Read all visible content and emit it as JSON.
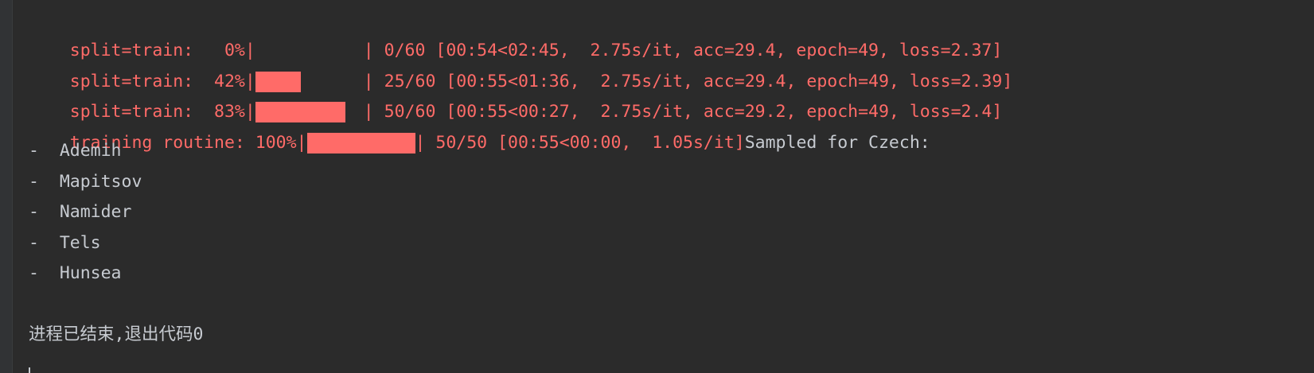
{
  "console": {
    "progress_lines": [
      {
        "label": "split=train:   0%|",
        "fraction": 0.0,
        "tail": "| 0/60 [00:54<02:45,  2.75s/it, acc=29.4, epoch=49, loss=2.37]"
      },
      {
        "label": "split=train:  42%|",
        "fraction": 0.42,
        "tail": "| 25/60 [00:55<01:36,  2.75s/it, acc=29.4, epoch=49, loss=2.39]"
      },
      {
        "label": "split=train:  83%|",
        "fraction": 0.83,
        "tail": "| 50/60 [00:55<00:27,  2.75s/it, acc=29.2, epoch=49, loss=2.4]"
      },
      {
        "label": "training routine: 100%|",
        "fraction": 1.0,
        "tail": "| 50/50 [00:55<00:00,  1.05s/it]",
        "trailing_output": "Sampled for Czech:"
      }
    ],
    "samples": [
      "-  Ademih",
      "-  Mapitsov",
      "-  Namider",
      "-  Tels",
      "-  Hunsea"
    ],
    "exit_message": "进程已结束,退出代码0",
    "colors": {
      "background": "#2b2b2b",
      "stderr_text": "#ff6b68",
      "stdout_text": "#c7cbd1",
      "gutter": "#313335"
    }
  }
}
